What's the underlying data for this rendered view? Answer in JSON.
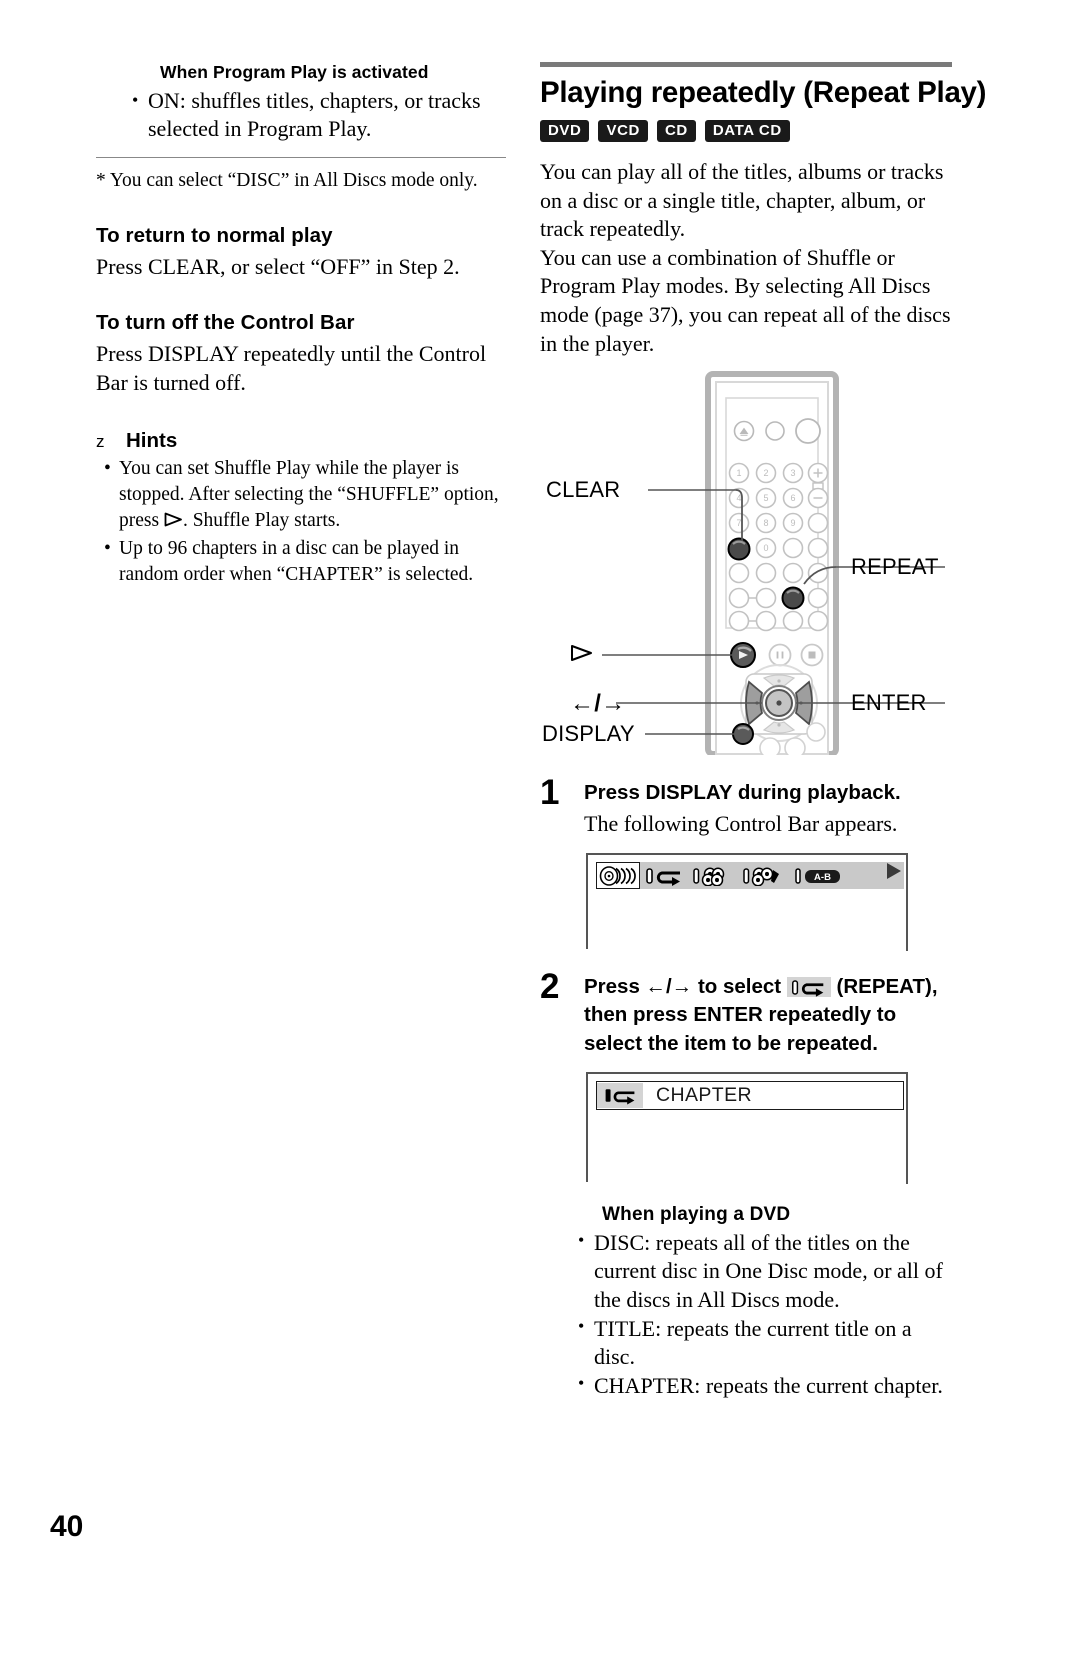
{
  "page": {
    "number": "40"
  },
  "left_column": {
    "program_note": {
      "heading": "When Program Play is activated",
      "bullet": "ON: shuffles titles, chapters, or tracks selected in Program Play."
    },
    "footnote": "* You can select “DISC” in All Discs mode only.",
    "sections": [
      {
        "heading": "To return to normal play",
        "body": "Press CLEAR, or select “OFF” in Step 2."
      },
      {
        "heading": "To turn off the Control Bar",
        "body": "Press DISPLAY repeatedly until the Control Bar is turned off."
      }
    ],
    "hints": {
      "glyph": "z",
      "heading": "Hints",
      "items": [
        {
          "text_before": "You can set Shuffle Play while the player is stopped. After selecting the “SHUFFLE” option, press",
          "icon": "play-triangle-icon",
          "text_after": ". Shuffle Play starts."
        },
        {
          "text_before": "Up to 96 chapters in a disc can be played in random order when “CHAPTER” is selected.",
          "icon": "",
          "text_after": ""
        }
      ]
    }
  },
  "right_column": {
    "title": "Playing repeatedly (Repeat Play)",
    "badges": [
      "DVD",
      "VCD",
      "CD",
      "DATA CD"
    ],
    "intro_paragraphs": [
      "You can play all of the titles, albums or tracks on a disc or a single title, chapter, album, or track repeatedly.",
      "You can use a combination of Shuffle or Program Play modes. By selecting All Discs mode (page 37), you can repeat all of the discs in the player."
    ],
    "remote_labels": {
      "clear": "CLEAR",
      "repeat": "REPEAT",
      "play": "▷",
      "enter": "ENTER",
      "arrows": "←/→",
      "display": "DISPLAY"
    },
    "steps": [
      {
        "number": "1",
        "title": "Press DISPLAY during playback.",
        "sub": "The following Control Bar appears."
      },
      {
        "number": "2",
        "title_part1": "Press ←/→ to select",
        "title_icon": "repeat-icon",
        "title_part2": "(REPEAT), then press ENTER repeatedly to select the item to be repeated."
      }
    ],
    "control_bar": {
      "items": [
        "disc-icon",
        "repeat-icon",
        "shuffle-icon",
        "program-icon",
        "a-b-repeat-icon"
      ],
      "ab_label": "A‣B",
      "play_indicator": "play-triangle-icon"
    },
    "chapter_screen": {
      "icon": "repeat-icon",
      "label": "CHAPTER"
    },
    "dvd_section": {
      "heading": "When playing a DVD",
      "items": [
        "DISC: repeats all of the titles on the current disc in One Disc mode, or all of the discs in All Discs mode.",
        "TITLE: repeats the current title on a disc.",
        "CHAPTER: repeats the current chapter."
      ]
    }
  }
}
